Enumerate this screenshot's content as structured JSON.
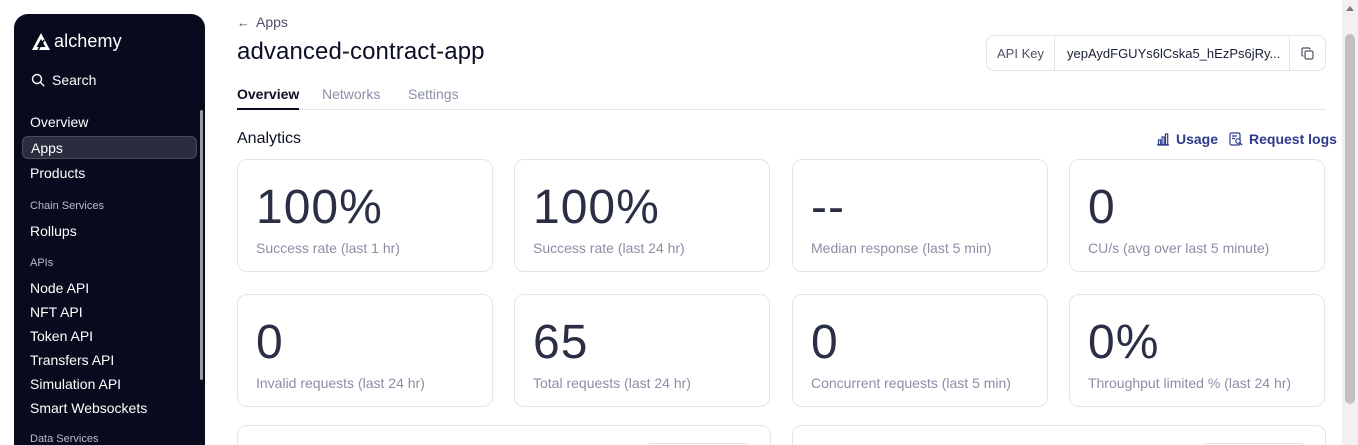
{
  "sidebar": {
    "brand": "alchemy",
    "search_label": "Search",
    "items": [
      {
        "label": "Overview"
      },
      {
        "label": "Apps"
      },
      {
        "label": "Products"
      }
    ],
    "sections": [
      {
        "title": "Chain Services",
        "items": [
          {
            "label": "Rollups"
          }
        ]
      },
      {
        "title": "APIs",
        "items": [
          {
            "label": "Node API"
          },
          {
            "label": "NFT API"
          },
          {
            "label": "Token API"
          },
          {
            "label": "Transfers API"
          },
          {
            "label": "Simulation API"
          },
          {
            "label": "Smart Websockets"
          }
        ]
      },
      {
        "title": "Data Services",
        "items": []
      }
    ]
  },
  "header": {
    "back_label": "Apps",
    "title": "advanced-contract-app",
    "api_key_label": "API Key",
    "api_key_value": "yepAydFGUYs6lCska5_hEzPs6jRy..."
  },
  "tabs": [
    {
      "label": "Overview",
      "active": true
    },
    {
      "label": "Networks",
      "active": false
    },
    {
      "label": "Settings",
      "active": false
    }
  ],
  "analytics": {
    "title": "Analytics",
    "usage_label": "Usage",
    "logs_label": "Request logs",
    "cards": [
      {
        "value": "100%",
        "label": "Success rate (last 1 hr)"
      },
      {
        "value": "100%",
        "label": "Success rate (last 24 hr)"
      },
      {
        "value": "--",
        "label": "Median response (last 5 min)"
      },
      {
        "value": "0",
        "label": "CU/s (avg over last 5 minute)"
      },
      {
        "value": "0",
        "label": "Invalid requests (last 24 hr)"
      },
      {
        "value": "65",
        "label": "Total requests (last 24 hr)"
      },
      {
        "value": "0",
        "label": "Concurrent requests (last 5 min)"
      },
      {
        "value": "0%",
        "label": "Throughput limited % (last 24 hr)"
      }
    ]
  },
  "colors": {
    "sidebar_bg": "#080b1e",
    "accent_link": "#2d3a8c",
    "card_value": "#2a2f45",
    "muted_text": "#8a8fa3"
  }
}
